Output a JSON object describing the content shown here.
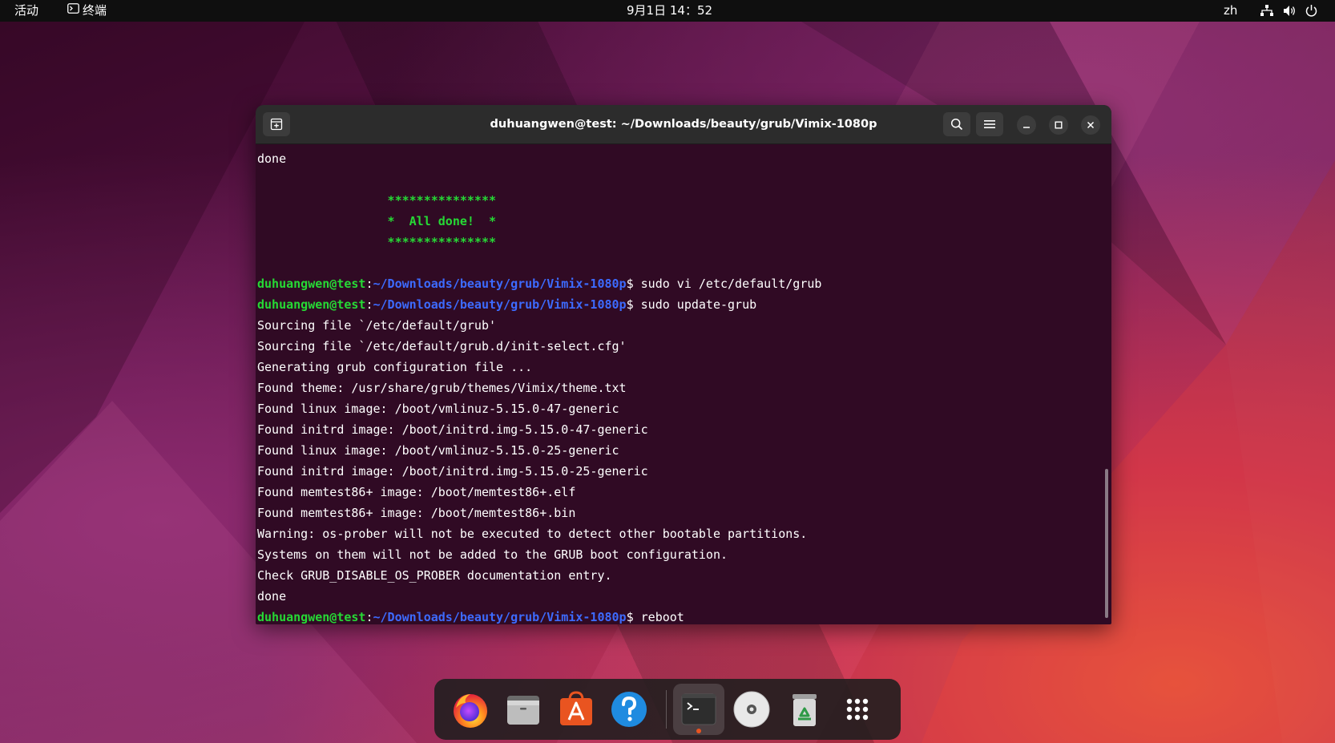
{
  "topbar": {
    "activities": "活动",
    "app_name": "终端",
    "datetime": "9月1日 14：52",
    "language": "zh"
  },
  "terminal": {
    "title": "duhuangwen@test: ~/Downloads/beauty/grub/Vimix-1080p",
    "prompt_user": "duhuangwen@test",
    "prompt_path": "~/Downloads/beauty/grub/Vimix-1080p",
    "lines": {
      "l01": "done",
      "l02": "",
      "l03": "                  ***************",
      "l04": "                  *  All done!  *",
      "l05": "                  ***************",
      "l06": "",
      "l07": "$ sudo vi /etc/default/grub",
      "l08": "$ sudo update-grub",
      "l09": "Sourcing file `/etc/default/grub'",
      "l10": "Sourcing file `/etc/default/grub.d/init-select.cfg'",
      "l11": "Generating grub configuration file ...",
      "l12": "Found theme: /usr/share/grub/themes/Vimix/theme.txt",
      "l13": "Found linux image: /boot/vmlinuz-5.15.0-47-generic",
      "l14": "Found initrd image: /boot/initrd.img-5.15.0-47-generic",
      "l15": "Found linux image: /boot/vmlinuz-5.15.0-25-generic",
      "l16": "Found initrd image: /boot/initrd.img-5.15.0-25-generic",
      "l17": "Found memtest86+ image: /boot/memtest86+.elf",
      "l18": "Found memtest86+ image: /boot/memtest86+.bin",
      "l19": "Warning: os-prober will not be executed to detect other bootable partitions.",
      "l20": "Systems on them will not be added to the GRUB boot configuration.",
      "l21": "Check GRUB_DISABLE_OS_PROBER documentation entry.",
      "l22": "done",
      "l23": "$ reboot"
    }
  },
  "dock": {
    "apps": [
      "firefox",
      "files",
      "app-center",
      "help",
      "terminal",
      "disc",
      "trash",
      "show-apps"
    ]
  },
  "colors": {
    "terminal_bg": "#300a24",
    "prompt_user": "#26d935",
    "prompt_path": "#3d6bff",
    "accent": "#e95420"
  }
}
